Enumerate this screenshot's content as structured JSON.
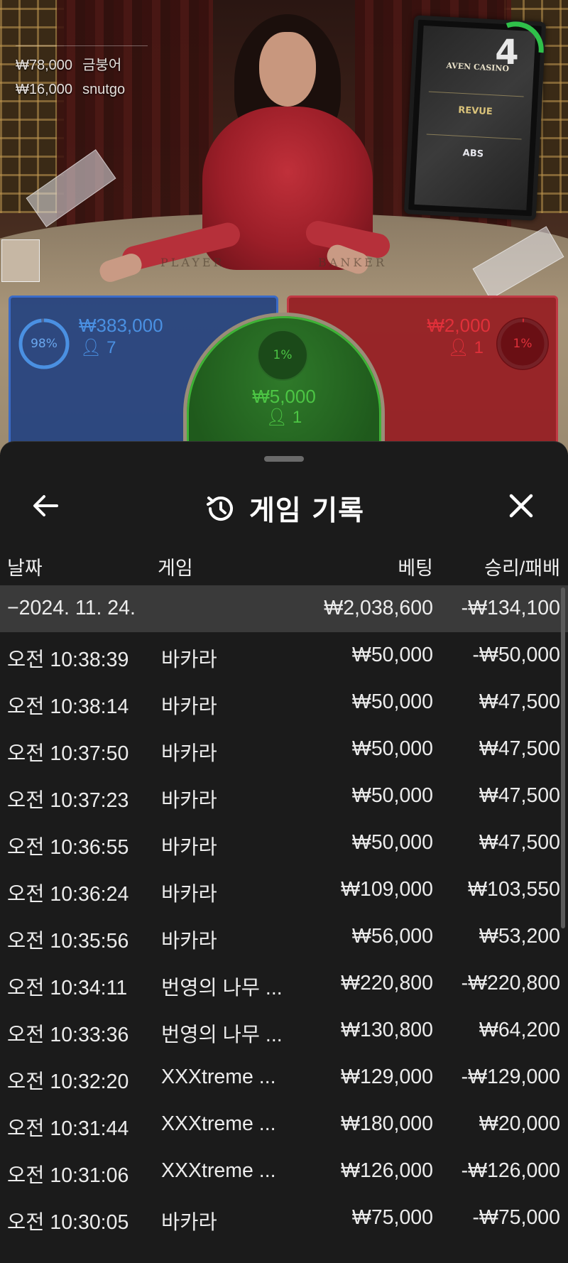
{
  "video": {
    "bettors": [
      {
        "amount": "₩78,000",
        "name": "금붕어"
      },
      {
        "amount": "₩16,000",
        "name": "snutgo"
      }
    ],
    "card_count": "4",
    "monitor_logos": [
      "AVEN CASINO",
      "REVUE",
      "ABS"
    ],
    "felt_labels": {
      "player": "PLAYER",
      "banker": "BANKER"
    }
  },
  "bet_zones": {
    "player": {
      "percent": "98%",
      "percent_value": 98,
      "amount": "₩383,000",
      "players": "7",
      "color": "#4a90e2"
    },
    "tie": {
      "percent": "1%",
      "percent_value": 1,
      "amount": "₩5,000",
      "players": "1",
      "color": "#3eb336"
    },
    "banker": {
      "percent": "1%",
      "percent_value": 1,
      "amount": "₩2,000",
      "players": "1",
      "color": "#d42a34"
    }
  },
  "history": {
    "title": "게임 기록",
    "columns": {
      "date": "날짜",
      "game": "게임",
      "bet": "베팅",
      "result": "승리/패배"
    },
    "date_group": {
      "date": "−2024. 11. 24.",
      "bet_total": "₩2,038,600",
      "result_total": "-₩134,100"
    },
    "rows": [
      {
        "time": "오전 10:38:39",
        "game": "바카라",
        "bet": "₩50,000",
        "result": "-₩50,000"
      },
      {
        "time": "오전 10:38:14",
        "game": "바카라",
        "bet": "₩50,000",
        "result": "₩47,500"
      },
      {
        "time": "오전 10:37:50",
        "game": "바카라",
        "bet": "₩50,000",
        "result": "₩47,500"
      },
      {
        "time": "오전 10:37:23",
        "game": "바카라",
        "bet": "₩50,000",
        "result": "₩47,500"
      },
      {
        "time": "오전 10:36:55",
        "game": "바카라",
        "bet": "₩50,000",
        "result": "₩47,500"
      },
      {
        "time": "오전 10:36:24",
        "game": "바카라",
        "bet": "₩109,000",
        "result": "₩103,550"
      },
      {
        "time": "오전 10:35:56",
        "game": "바카라",
        "bet": "₩56,000",
        "result": "₩53,200"
      },
      {
        "time": "오전 10:34:11",
        "game": "번영의 나무 ...",
        "bet": "₩220,800",
        "result": "-₩220,800"
      },
      {
        "time": "오전 10:33:36",
        "game": "번영의 나무 ...",
        "bet": "₩130,800",
        "result": "₩64,200"
      },
      {
        "time": "오전 10:32:20",
        "game": "XXXtreme ...",
        "bet": "₩129,000",
        "result": "-₩129,000"
      },
      {
        "time": "오전 10:31:44",
        "game": "XXXtreme ...",
        "bet": "₩180,000",
        "result": "₩20,000"
      },
      {
        "time": "오전 10:31:06",
        "game": "XXXtreme ...",
        "bet": "₩126,000",
        "result": "-₩126,000"
      },
      {
        "time": "오전 10:30:05",
        "game": "바카라",
        "bet": "₩75,000",
        "result": "-₩75,000"
      }
    ]
  },
  "icons": {
    "back": "arrow-left-icon",
    "history": "history-clock-icon",
    "close": "close-icon",
    "person": "person-icon"
  }
}
